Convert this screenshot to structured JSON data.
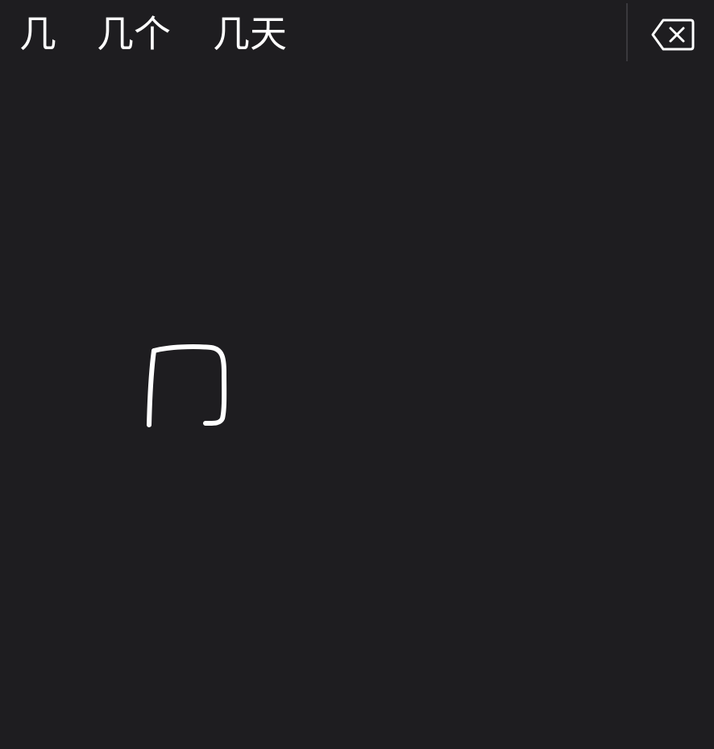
{
  "candidates": [
    "几",
    "几个",
    "几天"
  ],
  "icons": {
    "delete": "delete-backward-icon"
  },
  "colors": {
    "background": "#1e1d20",
    "text": "#ffffff",
    "divider": "#3a393d",
    "ink": "#ffffff"
  }
}
